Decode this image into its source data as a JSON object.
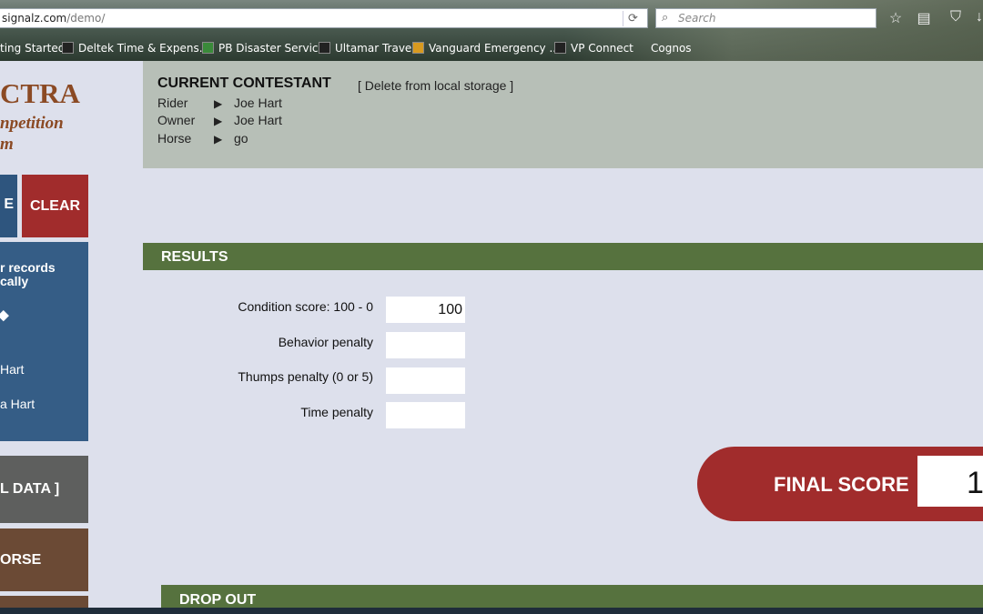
{
  "browser": {
    "url_prefix": "signalz.com",
    "url_suffix": "/demo/",
    "search_placeholder": "Search",
    "bookmarks": [
      {
        "label": "ting Started"
      },
      {
        "label": "Deltek Time & Expens..."
      },
      {
        "label": "PB Disaster Services"
      },
      {
        "label": "Ultamar Travel"
      },
      {
        "label": "Vanguard Emergency ..."
      },
      {
        "label": "VP Connect"
      },
      {
        "label": "Cognos"
      }
    ]
  },
  "logo": {
    "title": "CTRA",
    "sub1": "npetition",
    "sub2": "m"
  },
  "sidebar": {
    "top_left_label": "E",
    "clear_label": "CLEAR",
    "records_line1": "r records",
    "records_line2": "cally",
    "records_arrow": "◆",
    "records_name1": "Hart",
    "records_name2": "a Hart",
    "data_label": "L DATA ]",
    "horse_label": "ORSE"
  },
  "contestant": {
    "title": "CURRENT CONTESTANT",
    "delete_link": "[ Delete from local storage ]",
    "rows": [
      {
        "label": "Rider",
        "value": "Joe Hart"
      },
      {
        "label": "Owner",
        "value": "Joe Hart"
      },
      {
        "label": "Horse",
        "value": "go"
      }
    ]
  },
  "results": {
    "title": "RESULTS",
    "fields": [
      {
        "label": "Condition score: 100 - 0",
        "value": "100"
      },
      {
        "label": "Behavior penalty",
        "value": ""
      },
      {
        "label": "Thumps penalty (0 or 5)",
        "value": ""
      },
      {
        "label": "Time penalty",
        "value": ""
      }
    ],
    "final_label": "FINAL SCORE",
    "final_value": "1"
  },
  "dropout": {
    "title": "DROP OUT"
  },
  "colors": {
    "green_bar": "#56723e",
    "red": "#a12c2c",
    "blue": "#355d86",
    "brown": "#6b4a35",
    "panel": "#b7bfb7"
  }
}
